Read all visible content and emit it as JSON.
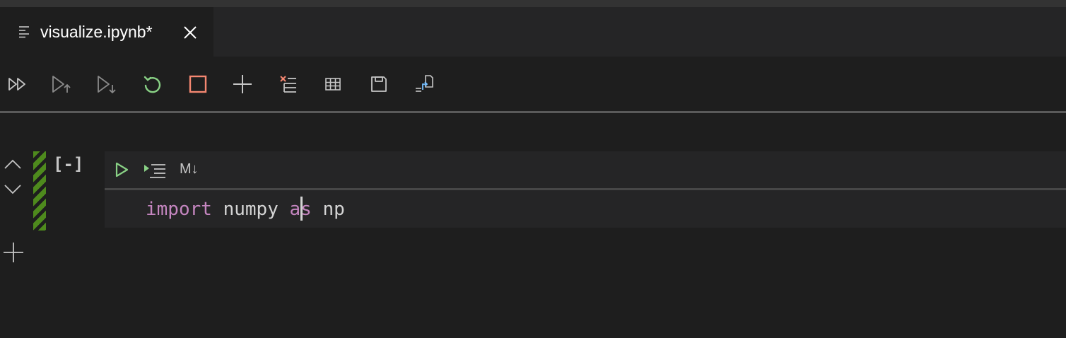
{
  "tab": {
    "title": "visualize.ipynb*",
    "icon": "notebook-file-icon",
    "close_icon": "close-icon"
  },
  "toolbar": {
    "buttons": [
      {
        "name": "run-all-cells-button",
        "icon": "run-all-icon",
        "color": "#c5c5c5"
      },
      {
        "name": "run-above-button",
        "icon": "run-above-icon",
        "color": "#8a8a8a"
      },
      {
        "name": "run-below-button",
        "icon": "run-below-icon",
        "color": "#8a8a8a"
      },
      {
        "name": "restart-kernel-button",
        "icon": "restart-icon",
        "color": "#89d185"
      },
      {
        "name": "interrupt-kernel-button",
        "icon": "stop-icon",
        "color": "#f48771"
      },
      {
        "name": "add-cell-button",
        "icon": "plus-icon",
        "color": "#c5c5c5"
      },
      {
        "name": "clear-outputs-button",
        "icon": "clear-outputs-icon",
        "color": "#c5c5c5"
      },
      {
        "name": "variable-explorer-button",
        "icon": "table-icon",
        "color": "#c5c5c5"
      },
      {
        "name": "save-button",
        "icon": "save-icon",
        "color": "#c5c5c5"
      },
      {
        "name": "export-button",
        "icon": "export-icon",
        "color": "#c5c5c5"
      }
    ]
  },
  "cell": {
    "execution_count": "[-]",
    "markdown_toggle": "M↓",
    "code": {
      "kw1": "import",
      "s1": " numpy ",
      "kw2_a": "a",
      "kw2_b": "s",
      "s2": " np"
    },
    "colors": {
      "keyword": "#c586c0",
      "text": "#d4d4d4",
      "status_stripe": "#4e8a1d",
      "run": "#89d185"
    }
  }
}
